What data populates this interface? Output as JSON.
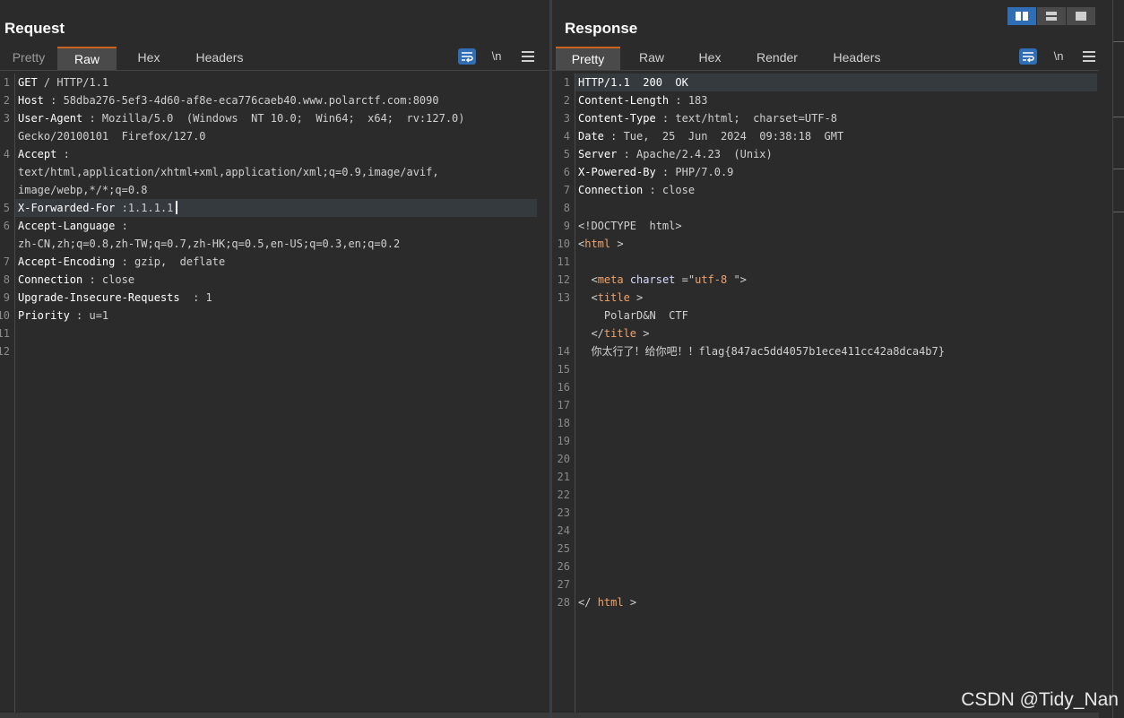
{
  "request": {
    "title": "Request",
    "tabs": [
      "Pretty",
      "Raw",
      "Hex",
      "Headers"
    ],
    "active_tab": "Raw",
    "tools": {
      "newline_label": "\\n"
    },
    "lines": [
      {
        "n": "1",
        "key": "GET",
        "rest": " / HTTP/1.1"
      },
      {
        "n": "2",
        "key": "Host",
        "rest": " : 58dba276-5ef3-4d60-af8e-eca776caeb40.www.polarctf.com:8090"
      },
      {
        "n": "3",
        "key": "User-Agent",
        "rest": " : Mozilla/5.0  (Windows  NT 10.0;  Win64;  x64;  rv:127.0)"
      },
      {
        "n": "",
        "key": "",
        "rest": "Gecko/20100101  Firefox/127.0"
      },
      {
        "n": "4",
        "key": "Accept",
        "rest": " :"
      },
      {
        "n": "",
        "key": "",
        "rest": "text/html,application/xhtml+xml,application/xml;q=0.9,image/avif,"
      },
      {
        "n": "",
        "key": "",
        "rest": "image/webp,*/*;q=0.8"
      },
      {
        "n": "5",
        "key": "X-Forwarded-For",
        "rest": " :1.1.1.1"
      },
      {
        "n": "6",
        "key": "Accept-Language",
        "rest": " :"
      },
      {
        "n": "",
        "key": "",
        "rest": "zh-CN,zh;q=0.8,zh-TW;q=0.7,zh-HK;q=0.5,en-US;q=0.3,en;q=0.2"
      },
      {
        "n": "7",
        "key": "Accept-Encoding",
        "rest": " : gzip,  deflate"
      },
      {
        "n": "8",
        "key": "Connection",
        "rest": " : close"
      },
      {
        "n": "9",
        "key": "Upgrade-Insecure-Requests",
        "rest": "  : 1"
      },
      {
        "n": "10",
        "key": "Priority",
        "rest": " : u=1"
      },
      {
        "n": "11",
        "key": "",
        "rest": ""
      },
      {
        "n": "12",
        "key": "",
        "rest": ""
      }
    ]
  },
  "response": {
    "title": "Response",
    "tabs": [
      "Pretty",
      "Raw",
      "Hex",
      "Render",
      "Headers"
    ],
    "active_tab": "Pretty",
    "tools": {
      "newline_label": "\\n"
    },
    "lines": [
      {
        "n": "1",
        "parts": [
          [
            "key",
            "HTTP/1.1  200  OK"
          ]
        ]
      },
      {
        "n": "2",
        "parts": [
          [
            "key",
            "Content-Length"
          ],
          [
            "plain",
            " : 183"
          ]
        ]
      },
      {
        "n": "3",
        "parts": [
          [
            "key",
            "Content-Type"
          ],
          [
            "plain",
            " : text/html;  charset=UTF-8"
          ]
        ]
      },
      {
        "n": "4",
        "parts": [
          [
            "key",
            "Date"
          ],
          [
            "plain",
            " : Tue,  25  Jun  2024  09:38:18  GMT"
          ]
        ]
      },
      {
        "n": "5",
        "parts": [
          [
            "key",
            "Server"
          ],
          [
            "plain",
            " : Apache/2.4.23  (Unix)"
          ]
        ]
      },
      {
        "n": "6",
        "parts": [
          [
            "key",
            "X-Powered-By"
          ],
          [
            "plain",
            " : PHP/7.0.9"
          ]
        ]
      },
      {
        "n": "7",
        "parts": [
          [
            "key",
            "Connection"
          ],
          [
            "plain",
            " : close"
          ]
        ]
      },
      {
        "n": "8",
        "parts": []
      },
      {
        "n": "9",
        "parts": [
          [
            "plain",
            "<!DOCTYPE  html>"
          ]
        ]
      },
      {
        "n": "10",
        "parts": [
          [
            "plain",
            "<"
          ],
          [
            "tag",
            "html"
          ],
          [
            "plain",
            " >"
          ]
        ]
      },
      {
        "n": "11",
        "parts": []
      },
      {
        "n": "12",
        "parts": [
          [
            "plain",
            "  <"
          ],
          [
            "tag",
            "meta"
          ],
          [
            "plain",
            " "
          ],
          [
            "attr",
            "charset"
          ],
          [
            "plain",
            " =\""
          ],
          [
            "str",
            "utf-8"
          ],
          [
            "plain",
            " \">"
          ]
        ]
      },
      {
        "n": "13",
        "parts": [
          [
            "plain",
            "  <"
          ],
          [
            "tag",
            "title"
          ],
          [
            "plain",
            " >"
          ]
        ]
      },
      {
        "n": "",
        "parts": [
          [
            "plain",
            "    PolarD&N  CTF"
          ]
        ]
      },
      {
        "n": "",
        "parts": [
          [
            "plain",
            "  </"
          ],
          [
            "tag",
            "title"
          ],
          [
            "plain",
            " >"
          ]
        ]
      },
      {
        "n": "14",
        "parts": [
          [
            "plain",
            "  你太行了！给你吧！！flag{847ac5dd4057b1ece411cc42a8dca4b7}"
          ]
        ]
      },
      {
        "n": "15",
        "parts": []
      },
      {
        "n": "16",
        "parts": []
      },
      {
        "n": "17",
        "parts": []
      },
      {
        "n": "18",
        "parts": []
      },
      {
        "n": "19",
        "parts": []
      },
      {
        "n": "20",
        "parts": []
      },
      {
        "n": "21",
        "parts": []
      },
      {
        "n": "22",
        "parts": []
      },
      {
        "n": "23",
        "parts": []
      },
      {
        "n": "24",
        "parts": []
      },
      {
        "n": "25",
        "parts": []
      },
      {
        "n": "26",
        "parts": []
      },
      {
        "n": "27",
        "parts": []
      },
      {
        "n": "28",
        "parts": [
          [
            "plain",
            "</ "
          ],
          [
            "tag",
            "html"
          ],
          [
            "plain",
            " >"
          ]
        ]
      }
    ]
  },
  "watermark": "CSDN @Tidy_Nan",
  "colors": {
    "accent": "#2f6db5",
    "tab_underline": "#c9621e",
    "tag": "#f0a36b"
  }
}
